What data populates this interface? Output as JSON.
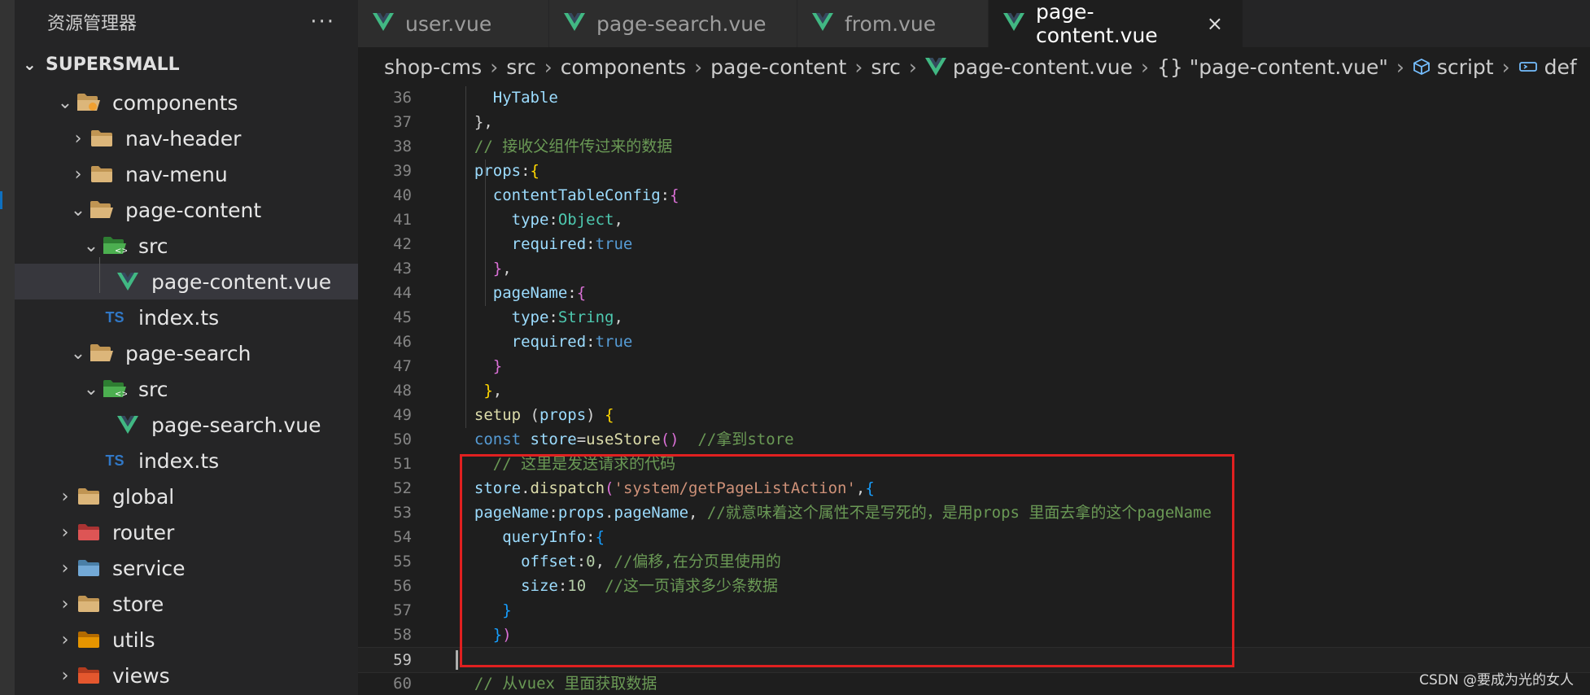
{
  "sidebar": {
    "title": "资源管理器",
    "more": "···",
    "project": "SUPERSMALL",
    "tree": [
      {
        "label": "components",
        "chevron": "⌄",
        "icon": "folder-open-components-icon",
        "selected": false
      },
      {
        "label": "nav-header",
        "chevron": "›",
        "icon": "folder-icon",
        "selected": false
      },
      {
        "label": "nav-menu",
        "chevron": "›",
        "icon": "folder-icon",
        "selected": false
      },
      {
        "label": "page-content",
        "chevron": "⌄",
        "icon": "folder-open-icon",
        "selected": false
      },
      {
        "label": "src",
        "chevron": "⌄",
        "icon": "folder-src-icon",
        "selected": false
      },
      {
        "label": "page-content.vue",
        "chevron": "",
        "icon": "vue-file-icon",
        "selected": true
      },
      {
        "label": "index.ts",
        "chevron": "",
        "icon": "ts-file-icon",
        "selected": false
      },
      {
        "label": "page-search",
        "chevron": "⌄",
        "icon": "folder-open-icon",
        "selected": false
      },
      {
        "label": "src",
        "chevron": "⌄",
        "icon": "folder-src-icon",
        "selected": false
      },
      {
        "label": "page-search.vue",
        "chevron": "",
        "icon": "vue-file-icon",
        "selected": false
      },
      {
        "label": "index.ts",
        "chevron": "",
        "icon": "ts-file-icon",
        "selected": false
      },
      {
        "label": "global",
        "chevron": "›",
        "icon": "folder-icon",
        "selected": false
      },
      {
        "label": "router",
        "chevron": "›",
        "icon": "folder-router-icon",
        "selected": false
      },
      {
        "label": "service",
        "chevron": "›",
        "icon": "folder-service-icon",
        "selected": false
      },
      {
        "label": "store",
        "chevron": "›",
        "icon": "folder-icon",
        "selected": false
      },
      {
        "label": "utils",
        "chevron": "›",
        "icon": "folder-utils-icon",
        "selected": false
      },
      {
        "label": "views",
        "chevron": "›",
        "icon": "folder-views-icon",
        "selected": false
      }
    ]
  },
  "tabs": [
    {
      "label": "user.vue",
      "active": false
    },
    {
      "label": "page-search.vue",
      "active": false
    },
    {
      "label": "from.vue",
      "active": false
    },
    {
      "label": "page-content.vue",
      "active": true,
      "close": "×"
    }
  ],
  "breadcrumb": [
    "shop-cms",
    "src",
    "components",
    "page-content",
    "src",
    "page-content.vue",
    "{} \"page-content.vue\"",
    "script",
    "def"
  ],
  "editor": {
    "lines": [
      {
        "n": "36",
        "tokens": [
          [
            "pl",
            "    "
          ],
          [
            "prop",
            "HyTable"
          ]
        ]
      },
      {
        "n": "37",
        "tokens": [
          [
            "pl",
            "  },"
          ]
        ]
      },
      {
        "n": "38",
        "tokens": [
          [
            "cm",
            "  // 接收父组件传过来的数据"
          ]
        ]
      },
      {
        "n": "39",
        "tokens": [
          [
            "prop",
            "  props"
          ],
          [
            "pl",
            ":"
          ],
          [
            "br1",
            "{"
          ]
        ]
      },
      {
        "n": "40",
        "tokens": [
          [
            "prop",
            "    contentTableConfig"
          ],
          [
            "pl",
            ":"
          ],
          [
            "br2",
            "{"
          ]
        ]
      },
      {
        "n": "41",
        "tokens": [
          [
            "prop",
            "      type"
          ],
          [
            "pl",
            ":"
          ],
          [
            "type",
            "Object"
          ],
          [
            "pl",
            ","
          ]
        ]
      },
      {
        "n": "42",
        "tokens": [
          [
            "prop",
            "      required"
          ],
          [
            "pl",
            ":"
          ],
          [
            "kw",
            "true"
          ]
        ]
      },
      {
        "n": "43",
        "tokens": [
          [
            "pl",
            "    "
          ],
          [
            "br2",
            "}"
          ],
          [
            "pl",
            ","
          ]
        ]
      },
      {
        "n": "44",
        "tokens": [
          [
            "prop",
            "    pageName"
          ],
          [
            "pl",
            ":"
          ],
          [
            "br2",
            "{"
          ]
        ]
      },
      {
        "n": "45",
        "tokens": [
          [
            "prop",
            "      type"
          ],
          [
            "pl",
            ":"
          ],
          [
            "type",
            "String"
          ],
          [
            "pl",
            ","
          ]
        ]
      },
      {
        "n": "46",
        "tokens": [
          [
            "prop",
            "      required"
          ],
          [
            "pl",
            ":"
          ],
          [
            "kw",
            "true"
          ]
        ]
      },
      {
        "n": "47",
        "tokens": [
          [
            "pl",
            "    "
          ],
          [
            "br2",
            "}"
          ]
        ]
      },
      {
        "n": "48",
        "tokens": [
          [
            "pl",
            "   "
          ],
          [
            "br1",
            "}"
          ],
          [
            "pl",
            ","
          ]
        ]
      },
      {
        "n": "49",
        "tokens": [
          [
            "fn",
            "  setup"
          ],
          [
            "pl",
            " ("
          ],
          [
            "prop",
            "props"
          ],
          [
            "pl",
            ") "
          ],
          [
            "br1",
            "{"
          ]
        ]
      },
      {
        "n": "50",
        "tokens": [
          [
            "kw",
            "  const "
          ],
          [
            "prop",
            "store"
          ],
          [
            "pl",
            "="
          ],
          [
            "fn",
            "useStore"
          ],
          [
            "br2",
            "()"
          ],
          [
            "pl",
            "  "
          ],
          [
            "cm",
            "//拿到store"
          ]
        ]
      },
      {
        "n": "51",
        "tokens": [
          [
            "cm",
            "    // 这里是发送请求的代码"
          ]
        ]
      },
      {
        "n": "52",
        "tokens": [
          [
            "prop",
            "  store"
          ],
          [
            "pl",
            "."
          ],
          [
            "fn",
            "dispatch"
          ],
          [
            "br2",
            "("
          ],
          [
            "str",
            "'system/getPageListAction'"
          ],
          [
            "pl",
            ","
          ],
          [
            "br3",
            "{"
          ]
        ]
      },
      {
        "n": "53",
        "tokens": [
          [
            "prop",
            "  pageName"
          ],
          [
            "pl",
            ":"
          ],
          [
            "prop",
            "props"
          ],
          [
            "pl",
            "."
          ],
          [
            "prop",
            "pageName"
          ],
          [
            "pl",
            ", "
          ],
          [
            "cm",
            "//就意味着这个属性不是写死的，是用props 里面去拿的这个pageName"
          ]
        ]
      },
      {
        "n": "54",
        "tokens": [
          [
            "prop",
            "     queryInfo"
          ],
          [
            "pl",
            ":"
          ],
          [
            "br3",
            "{"
          ]
        ]
      },
      {
        "n": "55",
        "tokens": [
          [
            "prop",
            "       offset"
          ],
          [
            "pl",
            ":"
          ],
          [
            "num-lit",
            "0"
          ],
          [
            "pl",
            ", "
          ],
          [
            "cm",
            "//偏移,在分页里使用的"
          ]
        ]
      },
      {
        "n": "56",
        "tokens": [
          [
            "prop",
            "       size"
          ],
          [
            "pl",
            ":"
          ],
          [
            "num-lit",
            "10"
          ],
          [
            "pl",
            "  "
          ],
          [
            "cm",
            "//这一页请求多少条数据"
          ]
        ]
      },
      {
        "n": "57",
        "tokens": [
          [
            "pl",
            "     "
          ],
          [
            "br3",
            "}"
          ]
        ]
      },
      {
        "n": "58",
        "tokens": [
          [
            "pl",
            "    "
          ],
          [
            "br3",
            "}"
          ],
          [
            "br2",
            ")"
          ]
        ]
      },
      {
        "n": "59",
        "tokens": []
      },
      {
        "n": "60",
        "tokens": [
          [
            "cm",
            "  // 从vuex 里面获取数据"
          ]
        ]
      }
    ],
    "current_line": "59"
  },
  "watermark": "CSDN @要成为光的女人",
  "colors": {
    "accent_vue": "#41b883",
    "highlight_box": "#e02020"
  }
}
